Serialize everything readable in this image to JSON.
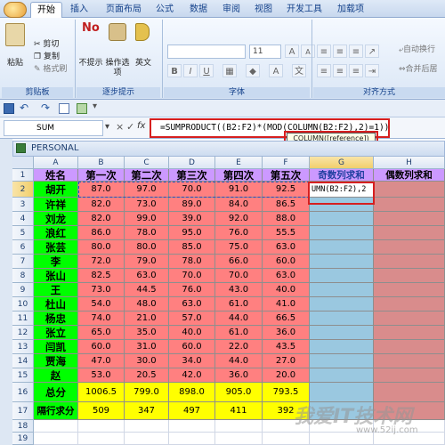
{
  "tabs": [
    "开始",
    "插入",
    "页面布局",
    "公式",
    "数据",
    "审阅",
    "视图",
    "开发工具",
    "加载项"
  ],
  "ribbon": {
    "clipboard": {
      "paste": "粘贴",
      "cut": "剪切",
      "copy": "复制",
      "format_painter": "格式刷",
      "label": "剪贴板"
    },
    "steps": {
      "no_show": "不提示",
      "operate": "操作选项",
      "english": "英文",
      "label": "逐步提示"
    },
    "font": {
      "size": "11",
      "label": "字体"
    },
    "align": {
      "wrap": "自动换行",
      "merge": "合并后居",
      "label": "对齐方式"
    }
  },
  "namebox": "SUM",
  "formula_bar_icons": [
    "×",
    "✓",
    "fx"
  ],
  "formula": "=SUMPRODUCT((B2:F2)*(MOD(COLUMN(B2:F2),2)=1))",
  "tooltip": "COLUMN([reference])",
  "window_title": "PERSONAL",
  "columns": [
    "A",
    "B",
    "C",
    "D",
    "E",
    "F",
    "G",
    "H"
  ],
  "header_row": [
    "姓名",
    "第一次",
    "第二次",
    "第三次",
    "第四次",
    "第五次",
    "奇数列求和",
    "偶数列求和"
  ],
  "rows": [
    {
      "name": "胡开",
      "vals": [
        "87.0",
        "97.0",
        "70.0",
        "91.0",
        "92.5"
      ]
    },
    {
      "name": "许祥",
      "vals": [
        "82.0",
        "73.0",
        "89.0",
        "84.0",
        "86.5"
      ]
    },
    {
      "name": "刘龙",
      "vals": [
        "82.0",
        "99.0",
        "39.0",
        "92.0",
        "88.0"
      ]
    },
    {
      "name": "浪红",
      "vals": [
        "86.0",
        "78.0",
        "95.0",
        "76.0",
        "55.5"
      ]
    },
    {
      "name": "张芸",
      "vals": [
        "80.0",
        "80.0",
        "85.0",
        "75.0",
        "63.0"
      ]
    },
    {
      "name": "李",
      "vals": [
        "72.0",
        "79.0",
        "78.0",
        "66.0",
        "60.0"
      ]
    },
    {
      "name": "张山",
      "vals": [
        "82.5",
        "63.0",
        "70.0",
        "70.0",
        "63.0"
      ]
    },
    {
      "name": "王",
      "vals": [
        "73.0",
        "44.5",
        "76.0",
        "43.0",
        "40.0"
      ]
    },
    {
      "name": "杜山",
      "vals": [
        "54.0",
        "48.0",
        "63.0",
        "61.0",
        "41.0"
      ]
    },
    {
      "name": "杨忠",
      "vals": [
        "74.0",
        "21.0",
        "57.0",
        "44.0",
        "66.5"
      ]
    },
    {
      "name": "张立",
      "vals": [
        "65.0",
        "35.0",
        "40.0",
        "61.0",
        "36.0"
      ]
    },
    {
      "name": "闫凯",
      "vals": [
        "60.0",
        "31.0",
        "60.0",
        "22.0",
        "43.5"
      ]
    },
    {
      "name": "贾海",
      "vals": [
        "47.0",
        "30.0",
        "34.0",
        "44.0",
        "27.0"
      ]
    },
    {
      "name": "赵",
      "vals": [
        "53.0",
        "20.5",
        "42.0",
        "36.0",
        "20.0"
      ]
    }
  ],
  "total_row": {
    "label": "总分",
    "vals": [
      "1006.5",
      "799.0",
      "898.0",
      "905.0",
      "793.5"
    ]
  },
  "rank_row": {
    "label": "隔行求分",
    "vals": [
      "509",
      "347",
      "497",
      "411",
      "392"
    ]
  },
  "g2_edit": "UMN(B2:F2),2",
  "row_numbers": [
    "1",
    "2",
    "3",
    "4",
    "5",
    "6",
    "7",
    "8",
    "9",
    "10",
    "11",
    "12",
    "13",
    "14",
    "15",
    "16",
    "17",
    "18",
    "19"
  ],
  "watermark": "我爱IT技术网",
  "watermark_url": "www.52ij.com",
  "colors": {
    "header_purple": "#cc99ff",
    "name_green": "#00ff00",
    "data_red": "#ff8080",
    "total_yellow": "#ffff00",
    "g_blue": "#9ac8e0",
    "h_rose": "#d98c8c",
    "highlight_red": "#d61f1f"
  }
}
